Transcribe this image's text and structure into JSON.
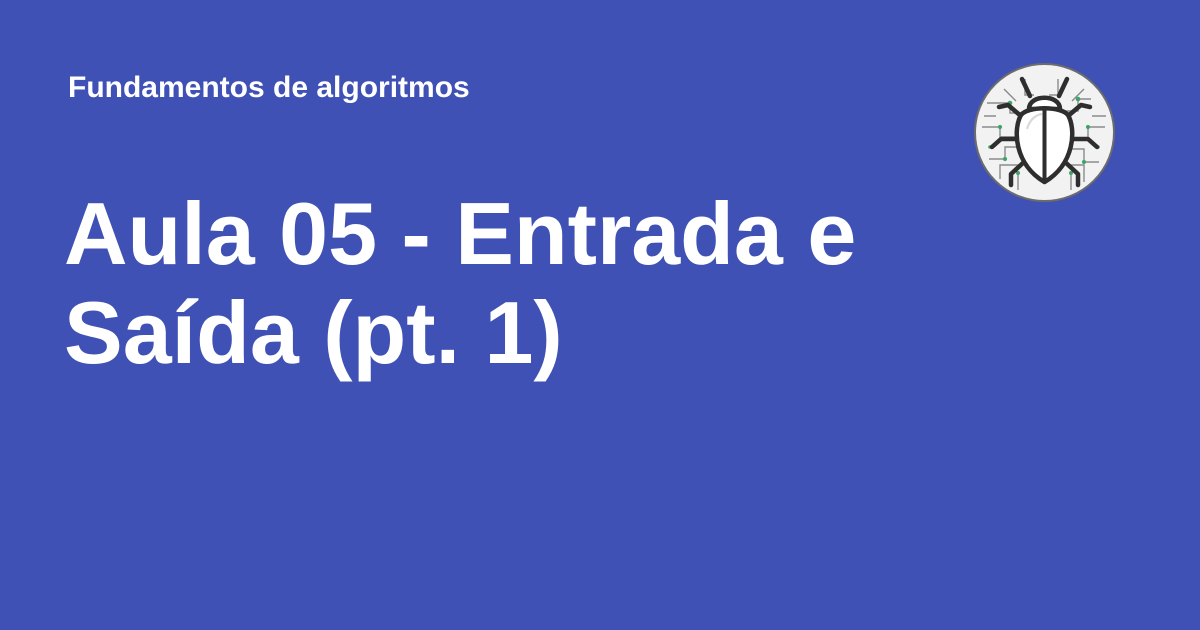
{
  "header": {
    "kicker": "Fundamentos de algoritmos"
  },
  "title": {
    "line1": "Aula 05 - Entrada e",
    "line2": "Saída (pt. 1)"
  },
  "logo": {
    "icon": "bug-icon"
  },
  "colors": {
    "background": "#3F51B5",
    "text": "#FFFFFF"
  }
}
